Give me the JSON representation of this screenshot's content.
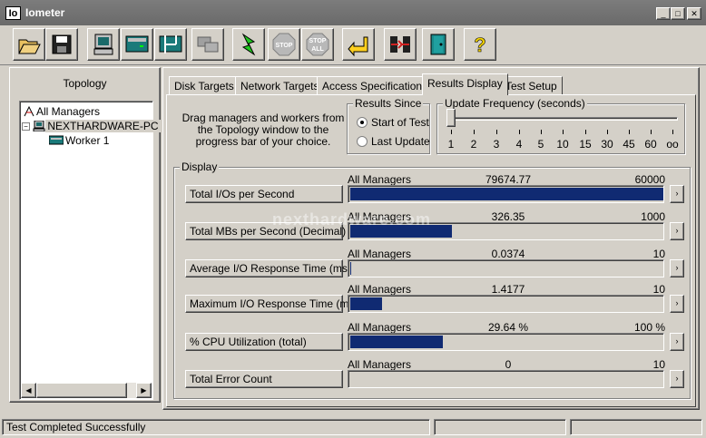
{
  "window": {
    "icon_text": "Io",
    "title": "Iometer"
  },
  "toolbar": {
    "buttons": [
      "open-icon",
      "save-icon",
      "new-disk-worker-icon",
      "new-network-worker-icon",
      "duplicate-worker-icon",
      "disconnect-icon",
      "start-icon",
      "stop-icon",
      "stop-all-icon",
      "reset-icon",
      "exit-icon",
      "quit-icon",
      "about-icon"
    ],
    "stop_label": "STOP",
    "stop_all_label": "STOP",
    "stop_all_sub": "ALL",
    "help_label": "?"
  },
  "topology": {
    "title": "Topology",
    "items": [
      "All Managers",
      "NEXTHARDWARE-PC",
      "Worker 1"
    ]
  },
  "tabs": [
    "Disk Targets",
    "Network Targets",
    "Access Specifications",
    "Results Display",
    "Test Setup"
  ],
  "active_tab": "Results Display",
  "help_text": "Drag managers and workers from the Topology window to the progress bar of your choice.",
  "results_since": {
    "title": "Results Since",
    "options": [
      "Start of Test",
      "Last Update"
    ],
    "selected": "Start of Test"
  },
  "update_frequency": {
    "title": "Update Frequency (seconds)",
    "ticks": [
      "1",
      "2",
      "3",
      "4",
      "5",
      "10",
      "15",
      "30",
      "45",
      "60",
      "oo"
    ],
    "selected_index": 0
  },
  "display": {
    "title": "Display",
    "metrics": [
      {
        "label": "Total I/Os per Second",
        "source": "All Managers",
        "value": "79674.77",
        "max": "60000",
        "fill": 1.0
      },
      {
        "label": "Total MBs per Second (Decimal)",
        "source": "All Managers",
        "value": "326.35",
        "max": "1000",
        "fill": 0.326
      },
      {
        "label": "Average I/O Response Time (ms)",
        "source": "All Managers",
        "value": "0.0374",
        "max": "10",
        "fill": 0.004
      },
      {
        "label": "Maximum I/O Response Time (ms)",
        "source": "All Managers",
        "value": "1.4177",
        "max": "10",
        "fill": 0.1
      },
      {
        "label": "% CPU Utilization (total)",
        "source": "All Managers",
        "value": "29.64 %",
        "max": "100 %",
        "fill": 0.296
      },
      {
        "label": "Total Error Count",
        "source": "All Managers",
        "value": "0",
        "max": "10",
        "fill": 0
      }
    ],
    "more_label": "›"
  },
  "watermark": "nexthardware.com",
  "status": {
    "text": "Test Completed Successfully"
  },
  "colors": {
    "bar_fill": "#102a72",
    "title_bar": "#6e6e6e",
    "window_bg": "#d4d0c8"
  }
}
